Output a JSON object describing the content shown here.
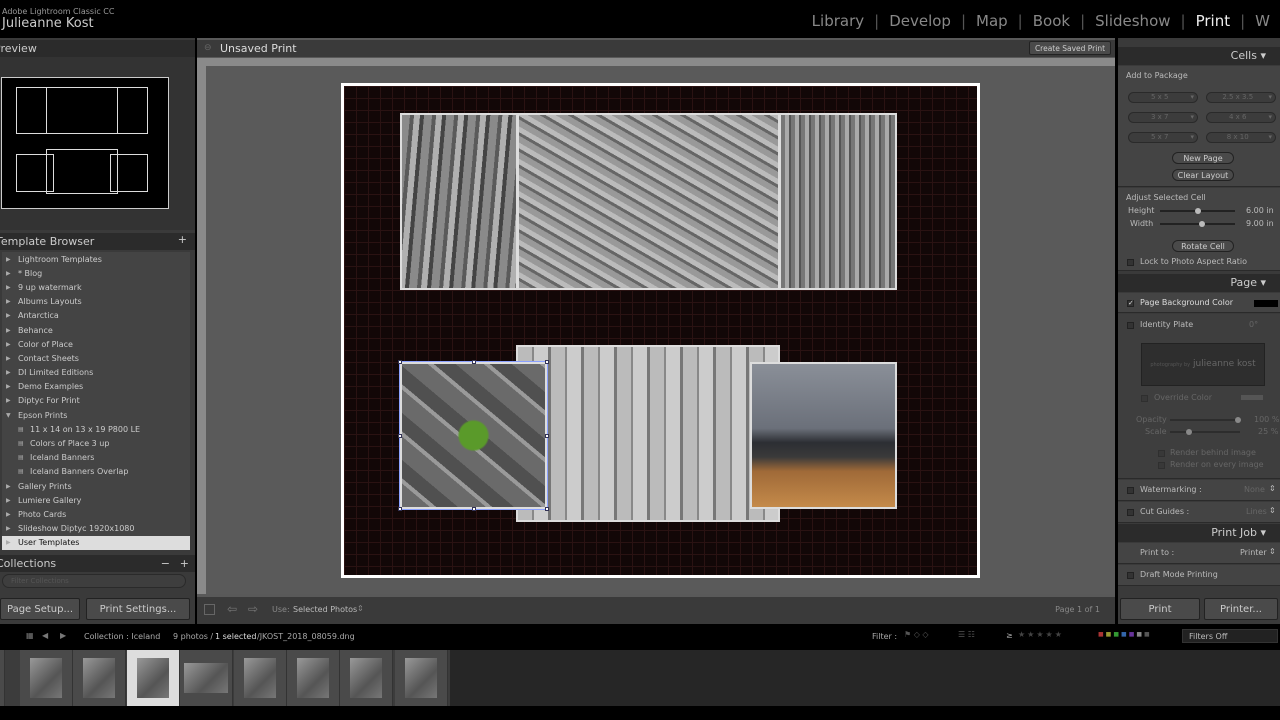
{
  "app": {
    "product": "Adobe Lightroom Classic CC",
    "identity": "Julieanne Kost"
  },
  "modules": [
    {
      "label": "Library"
    },
    {
      "label": "Develop"
    },
    {
      "label": "Map"
    },
    {
      "label": "Book"
    },
    {
      "label": "Slideshow"
    },
    {
      "label": "Print",
      "active": true
    },
    {
      "label": "W"
    }
  ],
  "left": {
    "preview_title": "Preview",
    "template_browser_title": "Template Browser",
    "templates": [
      {
        "label": "Lightroom Templates",
        "level": 0
      },
      {
        "label": "* Blog",
        "level": 0
      },
      {
        "label": "9 up watermark",
        "level": 0
      },
      {
        "label": "Albums Layouts",
        "level": 0
      },
      {
        "label": "Antarctica",
        "level": 0
      },
      {
        "label": "Behance",
        "level": 0
      },
      {
        "label": "Color of Place",
        "level": 0
      },
      {
        "label": "Contact Sheets",
        "level": 0
      },
      {
        "label": "DI Limited Editions",
        "level": 0
      },
      {
        "label": "Demo Examples",
        "level": 0
      },
      {
        "label": "Diptyc For Print",
        "level": 0
      },
      {
        "label": "Epson Prints",
        "level": 0,
        "open": true
      },
      {
        "label": "11 x 14 on 13 x 19 P800 LE",
        "level": 1
      },
      {
        "label": "Colors of Place 3 up",
        "level": 1
      },
      {
        "label": "Iceland Banners",
        "level": 1
      },
      {
        "label": "Iceland Banners Overlap",
        "level": 1
      },
      {
        "label": "Gallery Prints",
        "level": 0
      },
      {
        "label": "Lumiere Gallery",
        "level": 0
      },
      {
        "label": "Photo Cards",
        "level": 0
      },
      {
        "label": "Slideshow Diptyc 1920x1080",
        "level": 0
      },
      {
        "label": "User Templates",
        "level": 0,
        "selected": true
      }
    ],
    "collections_title": "Collections",
    "collections_search_placeholder": "Filter Collections",
    "page_setup": "Page Setup...",
    "print_settings": "Print Settings..."
  },
  "center": {
    "title": "Unsaved Print",
    "create_saved": "Create Saved Print",
    "use_label": "Use:",
    "use_value": "Selected Photos",
    "page_info": "Page 1 of 1"
  },
  "right": {
    "cells_title": "Cells",
    "add_to_package": "Add to Package",
    "sizes": [
      "5 x 5",
      "2.5 x 3.5",
      "3 x 7",
      "4 x 6",
      "5 x 7",
      "8 x 10"
    ],
    "new_page": "New Page",
    "clear_layout": "Clear Layout",
    "adjust_cell": "Adjust Selected Cell",
    "height_label": "Height",
    "height_value": "6.00 in",
    "height_fraction": 0.5,
    "width_label": "Width",
    "width_value": "9.00 in",
    "width_fraction": 0.55,
    "rotate_cell": "Rotate Cell",
    "lock_aspect": "Lock to Photo Aspect Ratio",
    "page_title": "Page",
    "page_bg": "Page Background Color",
    "page_bg_color": "#000000",
    "identity_plate": "Identity Plate",
    "identity_angle": "0°",
    "identity_text": "julieanne kost",
    "identity_prefix": "photography by",
    "override_color": "Override Color",
    "opacity_label": "Opacity",
    "opacity_value": "100 %",
    "scale_label": "Scale",
    "scale_value": "25 %",
    "render_behind": "Render behind image",
    "render_every": "Render on every image",
    "watermarking": "Watermarking :",
    "watermarking_value": "None",
    "cut_guides": "Cut Guides :",
    "cut_guides_value": "Lines",
    "print_job_title": "Print Job",
    "print_to": "Print to :",
    "print_to_value": "Printer",
    "draft_mode": "Draft Mode Printing",
    "print": "Print",
    "printer": "Printer..."
  },
  "filmstrip": {
    "collection": "Collection : Iceland",
    "count": "9 photos /",
    "selected": "1 selected",
    "filename": "/JKOST_2018_08059.dng",
    "filter_label": "Filter :",
    "filter_value": "Filters Off",
    "rating_op": "≥"
  }
}
